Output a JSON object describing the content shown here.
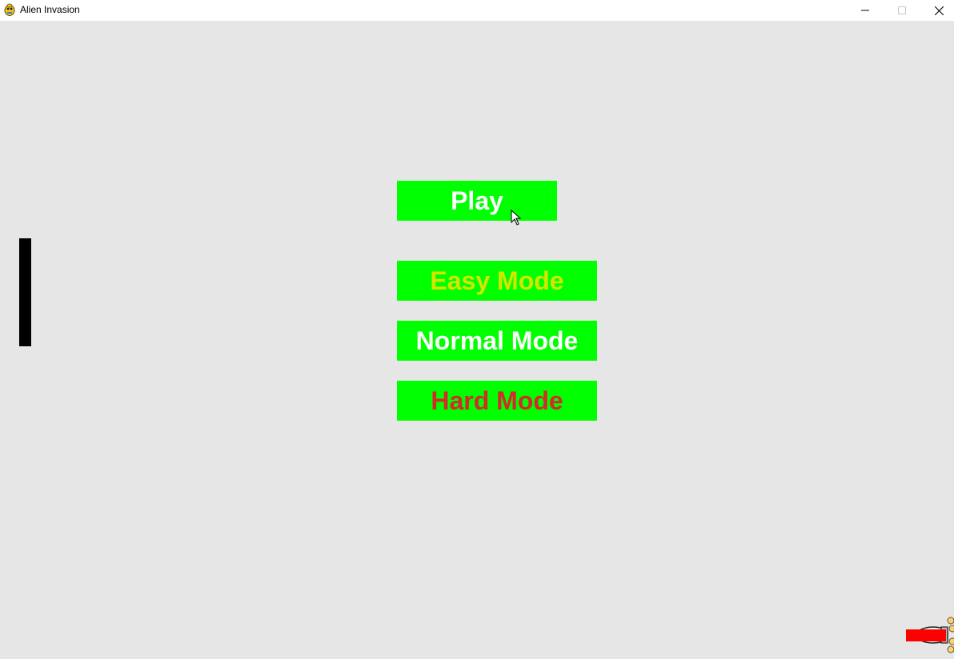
{
  "window": {
    "title": "Alien Invasion"
  },
  "menu": {
    "play_label": "Play",
    "easy_label": "Easy Mode",
    "normal_label": "Normal Mode",
    "hard_label": "Hard Mode"
  },
  "colors": {
    "background": "#e6e6e6",
    "button_bg": "#00ff00",
    "play_text": "#ffffff",
    "easy_text": "#d4e600",
    "normal_text": "#ffffff",
    "hard_text": "#d42a2a",
    "paddle": "#000000",
    "ship_bullet": "#ff0000"
  },
  "icons": {
    "app": "pygame-snake-icon",
    "minimize": "minimize-icon",
    "maximize": "maximize-icon",
    "close": "close-icon",
    "ship": "rocket-ship-icon",
    "cursor": "mouse-pointer-icon"
  }
}
